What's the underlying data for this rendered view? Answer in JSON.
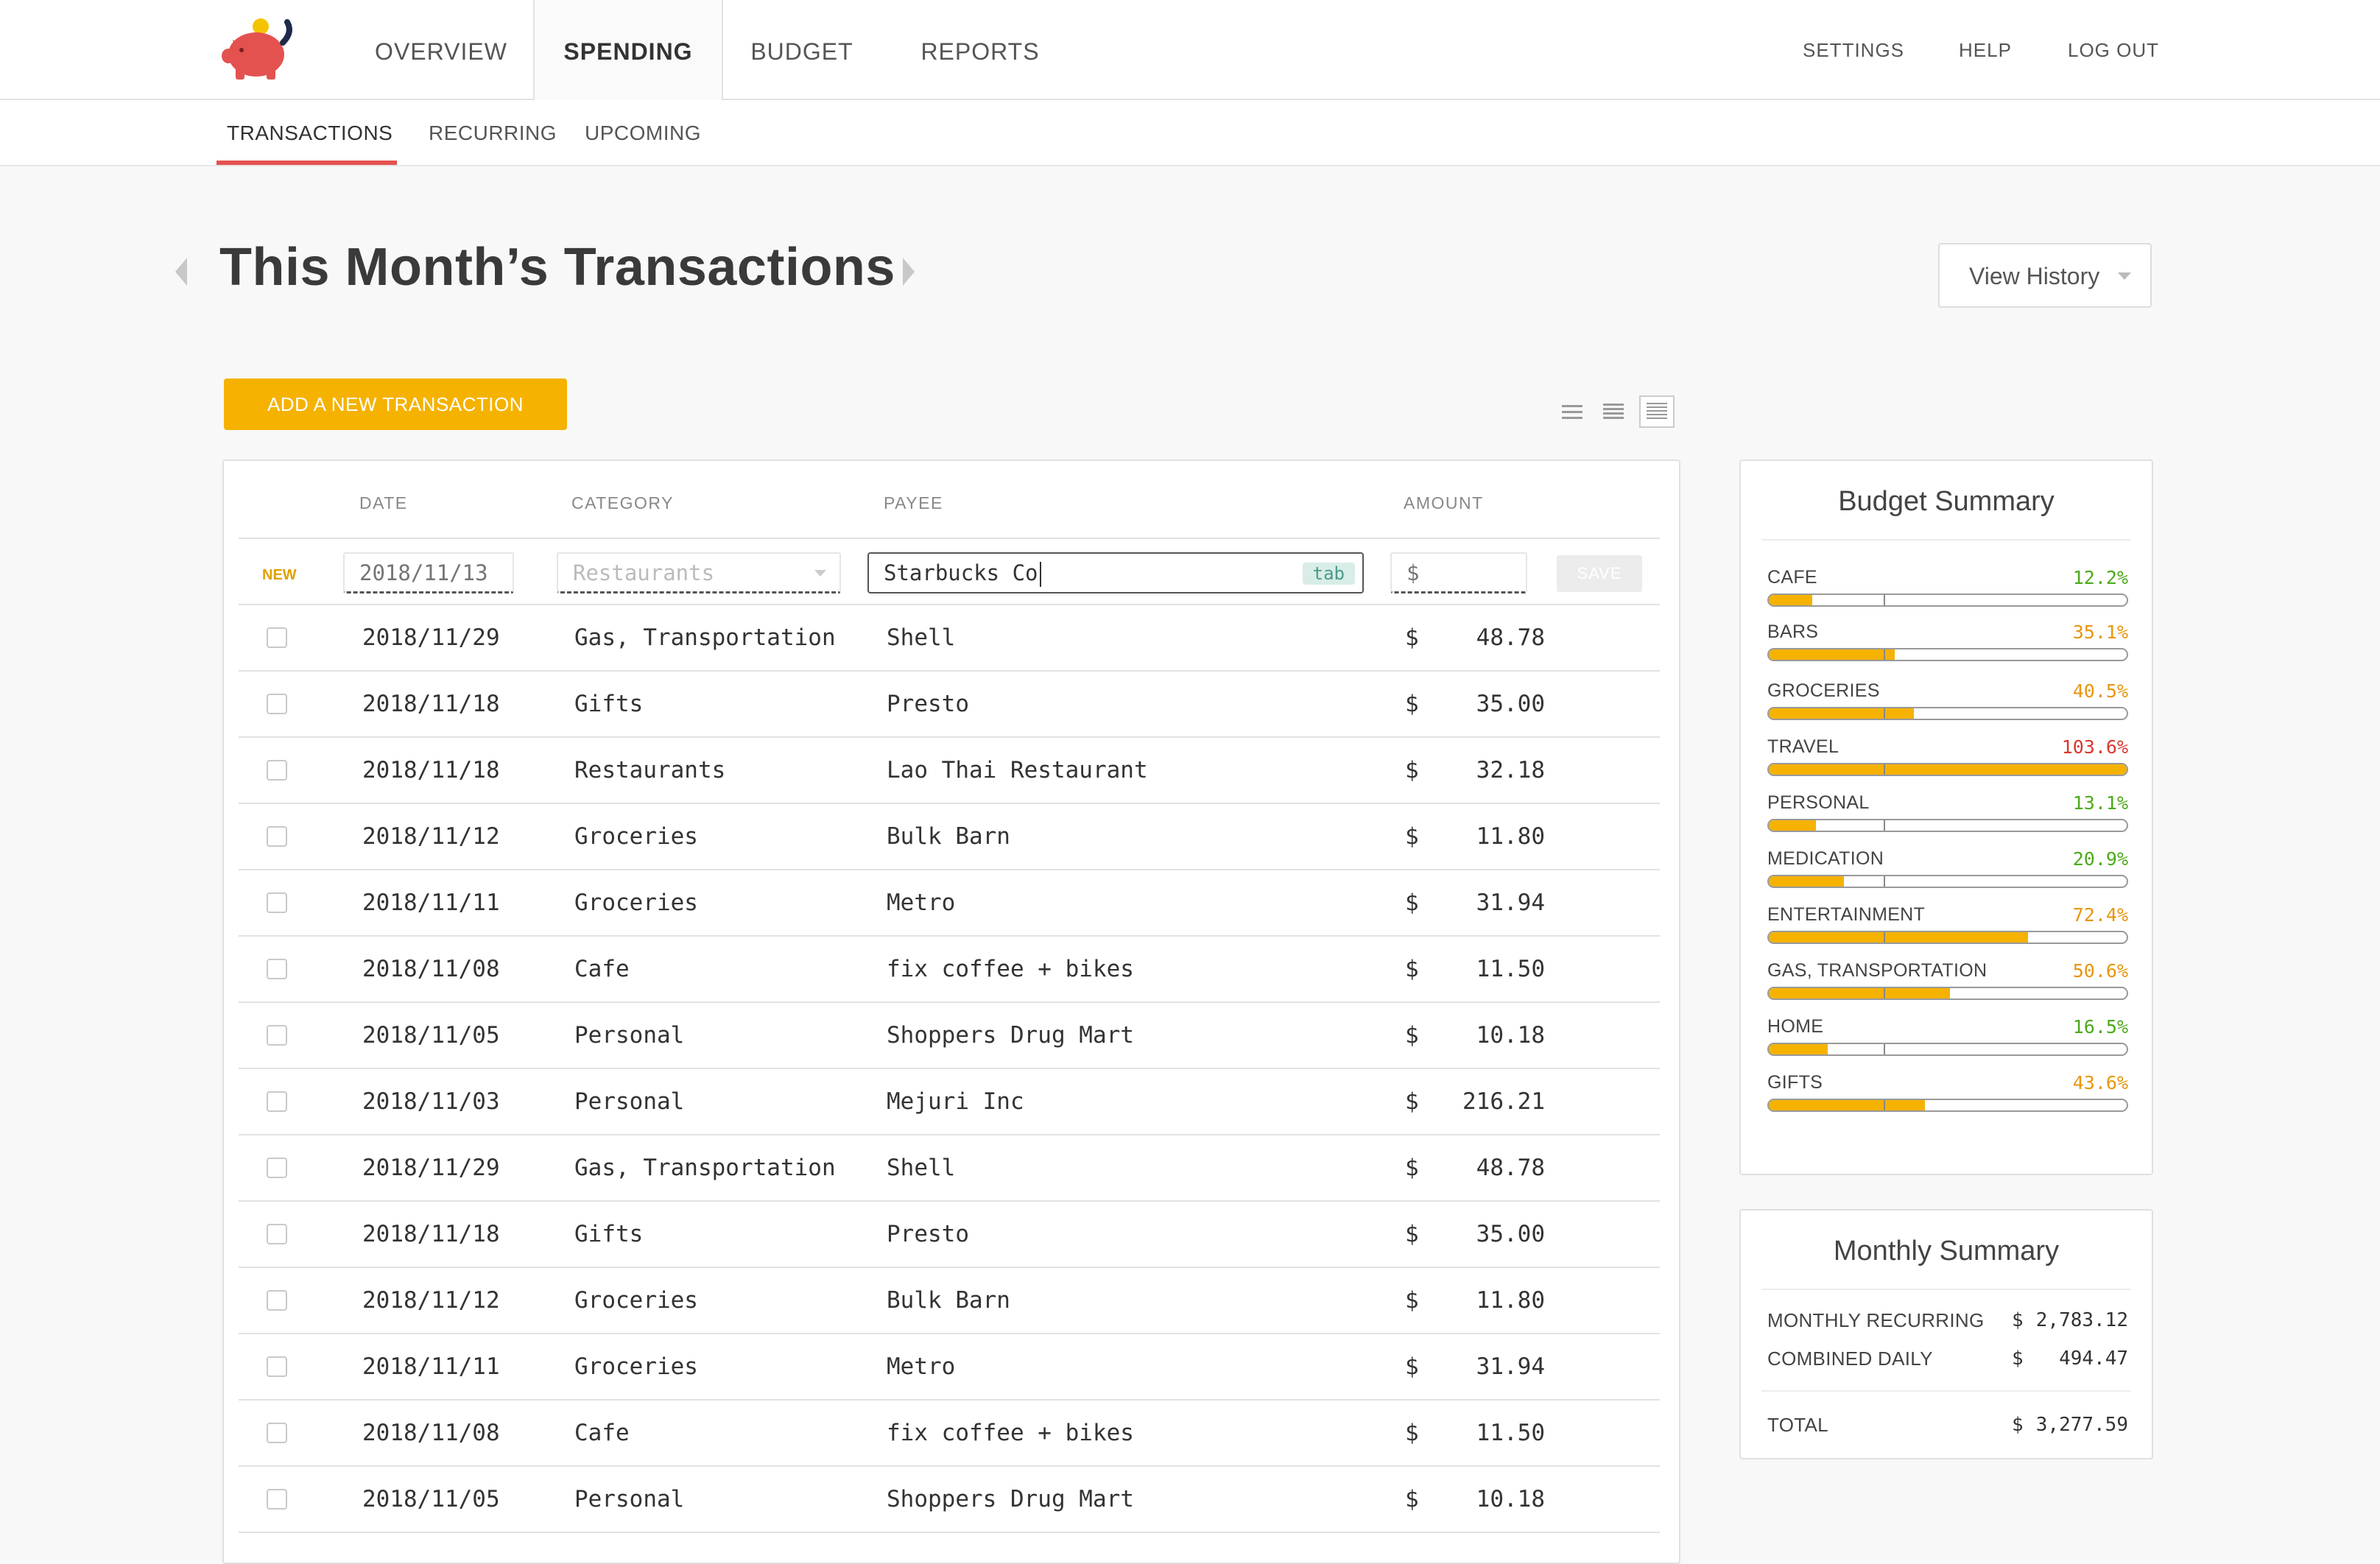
{
  "colors": {
    "accent": "#f5b200",
    "brand": "#e3524f",
    "good": "#4caa1a",
    "warn": "#e8950e",
    "over": "#d9372e"
  },
  "nav": {
    "logo": "piggy-bank-logo",
    "items": [
      "OVERVIEW",
      "SPENDING",
      "BUDGET",
      "REPORTS"
    ],
    "active": "SPENDING",
    "utility": [
      "SETTINGS",
      "HELP",
      "LOG OUT"
    ]
  },
  "subnav": {
    "items": [
      "TRANSACTIONS",
      "RECURRING",
      "UPCOMING"
    ],
    "active": "TRANSACTIONS"
  },
  "page": {
    "title": "This Month’s Transactions",
    "view_history": "View History",
    "add_button": "ADD A NEW TRANSACTION",
    "view_icons": [
      "list-compact-icon",
      "list-icon",
      "list-detailed-icon"
    ]
  },
  "table": {
    "headers": {
      "date": "DATE",
      "category": "CATEGORY",
      "payee": "PAYEE",
      "amount": "AMOUNT"
    },
    "new_row": {
      "label": "NEW",
      "date_placeholder": "2018/11/13",
      "category_placeholder": "Restaurants",
      "payee_value": "Starbucks Co",
      "payee_hint": "tab",
      "amount_placeholder": "$",
      "save_label": "SAVE"
    },
    "currency": "$",
    "rows": [
      {
        "date": "2018/11/29",
        "category": "Gas, Transportation",
        "payee": "Shell",
        "amount": "48.78"
      },
      {
        "date": "2018/11/18",
        "category": "Gifts",
        "payee": "Presto",
        "amount": "35.00"
      },
      {
        "date": "2018/11/18",
        "category": "Restaurants",
        "payee": "Lao Thai Restaurant",
        "amount": "32.18"
      },
      {
        "date": "2018/11/12",
        "category": "Groceries",
        "payee": "Bulk Barn",
        "amount": "11.80"
      },
      {
        "date": "2018/11/11",
        "category": "Groceries",
        "payee": "Metro",
        "amount": "31.94"
      },
      {
        "date": "2018/11/08",
        "category": "Cafe",
        "payee": "fix coffee + bikes",
        "amount": "11.50"
      },
      {
        "date": "2018/11/05",
        "category": "Personal",
        "payee": "Shoppers Drug Mart",
        "amount": "10.18"
      },
      {
        "date": "2018/11/03",
        "category": "Personal",
        "payee": "Mejuri Inc",
        "amount": "216.21"
      },
      {
        "date": "2018/11/29",
        "category": "Gas, Transportation",
        "payee": "Shell",
        "amount": "48.78"
      },
      {
        "date": "2018/11/18",
        "category": "Gifts",
        "payee": "Presto",
        "amount": "35.00"
      },
      {
        "date": "2018/11/12",
        "category": "Groceries",
        "payee": "Bulk Barn",
        "amount": "11.80"
      },
      {
        "date": "2018/11/11",
        "category": "Groceries",
        "payee": "Metro",
        "amount": "31.94"
      },
      {
        "date": "2018/11/08",
        "category": "Cafe",
        "payee": "fix coffee + bikes",
        "amount": "11.50"
      },
      {
        "date": "2018/11/05",
        "category": "Personal",
        "payee": "Shoppers Drug Mart",
        "amount": "10.18"
      }
    ]
  },
  "budget_summary": {
    "title": "Budget Summary",
    "items": [
      {
        "label": "CAFE",
        "pct_text": "12.2%",
        "pct": 12.2,
        "status": "good"
      },
      {
        "label": "BARS",
        "pct_text": "35.1%",
        "pct": 35.1,
        "status": "warn"
      },
      {
        "label": "GROCERIES",
        "pct_text": "40.5%",
        "pct": 40.5,
        "status": "warn"
      },
      {
        "label": "TRAVEL",
        "pct_text": "103.6%",
        "pct": 103.6,
        "status": "over"
      },
      {
        "label": "PERSONAL",
        "pct_text": "13.1%",
        "pct": 13.1,
        "status": "good"
      },
      {
        "label": "MEDICATION",
        "pct_text": "20.9%",
        "pct": 20.9,
        "status": "good"
      },
      {
        "label": "ENTERTAINMENT",
        "pct_text": "72.4%",
        "pct": 72.4,
        "status": "warn"
      },
      {
        "label": "GAS, TRANSPORTATION",
        "pct_text": "50.6%",
        "pct": 50.6,
        "status": "warn"
      },
      {
        "label": "HOME",
        "pct_text": "16.5%",
        "pct": 16.5,
        "status": "good"
      },
      {
        "label": "GIFTS",
        "pct_text": "43.6%",
        "pct": 43.6,
        "status": "warn"
      }
    ]
  },
  "monthly_summary": {
    "title": "Monthly Summary",
    "currency": "$",
    "rows": [
      {
        "label": "MONTHLY RECURRING",
        "value": "2,783.12"
      },
      {
        "label": "COMBINED DAILY",
        "value": "494.47"
      }
    ],
    "total": {
      "label": "TOTAL",
      "value": "3,277.59"
    }
  }
}
